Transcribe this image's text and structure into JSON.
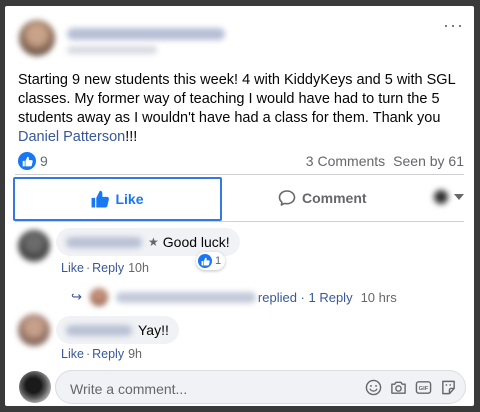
{
  "post": {
    "text": "Starting 9 new students this week! 4 with KiddyKeys and 5 with SGL classes. My former way of teaching I would have had to turn the 5 students away as I wouldn't have had a class for them. Thank you ",
    "mention": "Daniel Patterson",
    "text_end": "!!!",
    "reaction_count": "9",
    "comments_label": "3 Comments",
    "seen_label": "Seen by 61"
  },
  "actions": {
    "like_label": "Like",
    "comment_label": "Comment"
  },
  "comments": [
    {
      "text": "Good luck!",
      "like_label": "Like",
      "reply_label": "Reply",
      "time": "10h",
      "reaction_count": "1"
    },
    {
      "text": "Yay!!",
      "like_label": "Like",
      "reply_label": "Reply",
      "time": "9h"
    }
  ],
  "reply_thread": {
    "text": "replied · 1 Reply",
    "time": "10 hrs"
  },
  "composer": {
    "placeholder": "Write a comment..."
  },
  "icons": {
    "like": "thumbs-up-icon",
    "comment": "speech-bubble-icon",
    "emoji": "smiley-icon",
    "camera": "camera-icon",
    "gif": "gif-icon",
    "sticker": "sticker-icon"
  },
  "colors": {
    "accent": "#1877f2",
    "link": "#385898",
    "secondary_text": "#65676b",
    "bubble": "#f0f2f5"
  }
}
